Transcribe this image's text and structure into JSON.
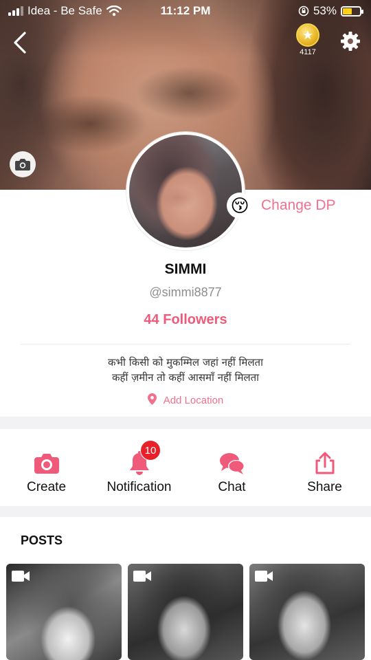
{
  "status_bar": {
    "carrier": "Idea - Be Safe",
    "time": "11:12 PM",
    "battery": "53%",
    "battery_level": 0.53
  },
  "header": {
    "back_icon": "chevron-left-icon",
    "coins": "4117",
    "settings_icon": "gear-icon",
    "cover_camera_icon": "camera-icon"
  },
  "profile": {
    "emoji": "😚",
    "change_dp_label": "Change DP",
    "name": "SIMMI",
    "handle": "@simmi8877",
    "followers": "44 Followers",
    "bio_line1": "कभी किसी को मुकम्मिल जहां नहीं मिलता",
    "bio_line2": "कहीं ज़मीन तो कहीं आसमाँ नहीं मिलता",
    "add_location": "Add Location"
  },
  "actions": {
    "create": "Create",
    "notification": "Notification",
    "notification_count": "10",
    "chat": "Chat",
    "share": "Share"
  },
  "posts": {
    "title": "POSTS"
  },
  "colors": {
    "accent": "#ef5a7a",
    "accent_light": "#f0708e",
    "badge": "#e8202a"
  }
}
